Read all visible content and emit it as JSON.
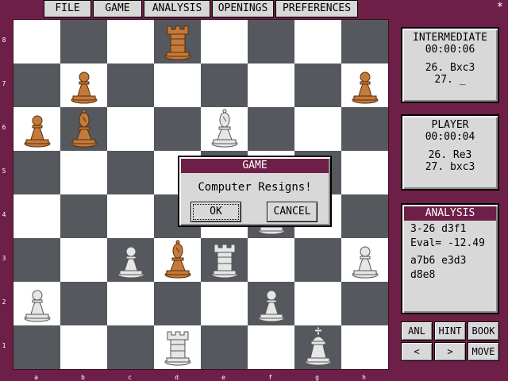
{
  "menu": [
    "FILE",
    "GAME",
    "ANALYSIS",
    "OPENINGS",
    "PREFERENCES"
  ],
  "close_glyph": "*",
  "board": {
    "ranks": [
      "8",
      "7",
      "6",
      "5",
      "4",
      "3",
      "2",
      "1"
    ],
    "files": [
      "a",
      "b",
      "c",
      "d",
      "e",
      "f",
      "g",
      "h"
    ],
    "pieces": [
      {
        "square": "d8",
        "type": "rook",
        "color": "brown"
      },
      {
        "square": "b7",
        "type": "pawn",
        "color": "brown"
      },
      {
        "square": "h7",
        "type": "pawn",
        "color": "brown"
      },
      {
        "square": "a6",
        "type": "pawn",
        "color": "brown"
      },
      {
        "square": "b6",
        "type": "bishop",
        "color": "brown"
      },
      {
        "square": "e6",
        "type": "bishop",
        "color": "white"
      },
      {
        "square": "f4",
        "type": "pawn",
        "color": "white"
      },
      {
        "square": "c3",
        "type": "pawn",
        "color": "white"
      },
      {
        "square": "d3",
        "type": "bishop",
        "color": "brown"
      },
      {
        "square": "e3",
        "type": "rook",
        "color": "white"
      },
      {
        "square": "h3",
        "type": "pawn",
        "color": "white"
      },
      {
        "square": "a2",
        "type": "pawn",
        "color": "white"
      },
      {
        "square": "f2",
        "type": "pawn",
        "color": "white"
      },
      {
        "square": "d1",
        "type": "rook",
        "color": "white"
      },
      {
        "square": "g1",
        "type": "king",
        "color": "white"
      }
    ]
  },
  "computer_panel": {
    "name": "INTERMEDIATE",
    "clock": "00:00:06",
    "move1": "26. Bxc3",
    "move2": "27. _"
  },
  "player_panel": {
    "name": "PLAYER",
    "clock": "00:00:04",
    "move1": "26. Re3",
    "move2": "27. bxc3"
  },
  "analysis_panel": {
    "title": "ANALYSIS",
    "line1": "3-26  d3f1",
    "line2": "Eval= -12.49",
    "line3": "a7b6  e3d3",
    "line4": "d8e8"
  },
  "controls": [
    "ANL",
    "HINT",
    "BOOK",
    "<",
    ">",
    "MOVE"
  ],
  "dialog": {
    "title": "GAME",
    "message": "Computer Resigns!",
    "ok": "OK",
    "cancel": "CANCEL"
  },
  "colors": {
    "frame": "#6e1f47",
    "dark_square": "#55585d",
    "light_square": "#ffffff",
    "brown_piece": "#c47a3a",
    "white_piece": "#e6e6e6"
  }
}
